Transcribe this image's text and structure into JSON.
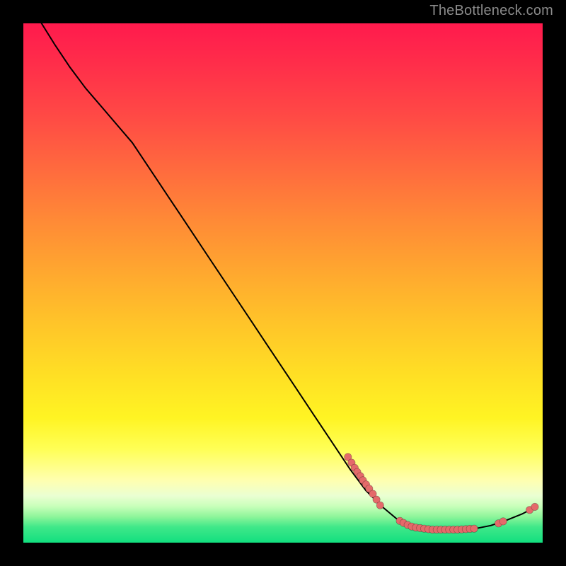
{
  "watermark": "TheBottleneck.com",
  "colors": {
    "point": "#e46a6a",
    "curve": "#000000",
    "frame": "#000000"
  },
  "chart_data": {
    "type": "line",
    "title": "",
    "xlabel": "",
    "ylabel": "",
    "x_range": [
      0,
      100
    ],
    "y_range": [
      0,
      100
    ],
    "curve": [
      {
        "x": 3.5,
        "y": 100.0
      },
      {
        "x": 6.0,
        "y": 96.0
      },
      {
        "x": 9.0,
        "y": 91.5
      },
      {
        "x": 12.0,
        "y": 87.5
      },
      {
        "x": 15.0,
        "y": 84.0
      },
      {
        "x": 18.0,
        "y": 80.5
      },
      {
        "x": 21.0,
        "y": 77.0
      },
      {
        "x": 24.0,
        "y": 72.5
      },
      {
        "x": 28.0,
        "y": 66.5
      },
      {
        "x": 32.0,
        "y": 60.5
      },
      {
        "x": 36.0,
        "y": 54.5
      },
      {
        "x": 40.0,
        "y": 48.5
      },
      {
        "x": 44.0,
        "y": 42.5
      },
      {
        "x": 48.0,
        "y": 36.5
      },
      {
        "x": 52.0,
        "y": 30.5
      },
      {
        "x": 56.0,
        "y": 24.5
      },
      {
        "x": 60.0,
        "y": 18.5
      },
      {
        "x": 63.0,
        "y": 14.0
      },
      {
        "x": 66.0,
        "y": 10.0
      },
      {
        "x": 69.0,
        "y": 7.0
      },
      {
        "x": 72.0,
        "y": 4.5
      },
      {
        "x": 75.0,
        "y": 3.0
      },
      {
        "x": 78.0,
        "y": 2.5
      },
      {
        "x": 81.0,
        "y": 2.5
      },
      {
        "x": 84.0,
        "y": 2.5
      },
      {
        "x": 87.0,
        "y": 2.7
      },
      {
        "x": 90.0,
        "y": 3.3
      },
      {
        "x": 93.0,
        "y": 4.3
      },
      {
        "x": 96.0,
        "y": 5.5
      },
      {
        "x": 98.5,
        "y": 6.8
      }
    ],
    "clusters": [
      {
        "note": "upper-left diagonal cluster near the steep descent",
        "points": [
          {
            "x": 62.5,
            "y": 16.5
          },
          {
            "x": 63.2,
            "y": 15.4
          },
          {
            "x": 63.8,
            "y": 14.4
          },
          {
            "x": 64.3,
            "y": 13.6
          },
          {
            "x": 64.9,
            "y": 12.8
          },
          {
            "x": 65.4,
            "y": 12.0
          },
          {
            "x": 66.0,
            "y": 11.2
          },
          {
            "x": 66.6,
            "y": 10.4
          },
          {
            "x": 67.3,
            "y": 9.4
          },
          {
            "x": 68.0,
            "y": 8.3
          },
          {
            "x": 68.7,
            "y": 7.2
          }
        ]
      },
      {
        "note": "dense bottom cluster along the valley",
        "points": [
          {
            "x": 72.5,
            "y": 4.2
          },
          {
            "x": 73.2,
            "y": 3.8
          },
          {
            "x": 74.0,
            "y": 3.4
          },
          {
            "x": 74.8,
            "y": 3.1
          },
          {
            "x": 75.6,
            "y": 2.9
          },
          {
            "x": 76.4,
            "y": 2.8
          },
          {
            "x": 77.2,
            "y": 2.7
          },
          {
            "x": 78.0,
            "y": 2.6
          },
          {
            "x": 78.8,
            "y": 2.5
          },
          {
            "x": 79.6,
            "y": 2.5
          },
          {
            "x": 80.4,
            "y": 2.5
          },
          {
            "x": 81.2,
            "y": 2.5
          },
          {
            "x": 82.0,
            "y": 2.5
          },
          {
            "x": 82.8,
            "y": 2.5
          },
          {
            "x": 83.6,
            "y": 2.5
          },
          {
            "x": 84.4,
            "y": 2.55
          },
          {
            "x": 85.2,
            "y": 2.6
          },
          {
            "x": 86.0,
            "y": 2.65
          },
          {
            "x": 86.8,
            "y": 2.7
          }
        ]
      },
      {
        "note": "short rising pair on the right upswing",
        "points": [
          {
            "x": 91.5,
            "y": 3.7
          },
          {
            "x": 92.4,
            "y": 4.1
          }
        ]
      },
      {
        "note": "top-right pair at end of tail",
        "points": [
          {
            "x": 97.5,
            "y": 6.3
          },
          {
            "x": 98.5,
            "y": 6.9
          }
        ]
      }
    ]
  }
}
